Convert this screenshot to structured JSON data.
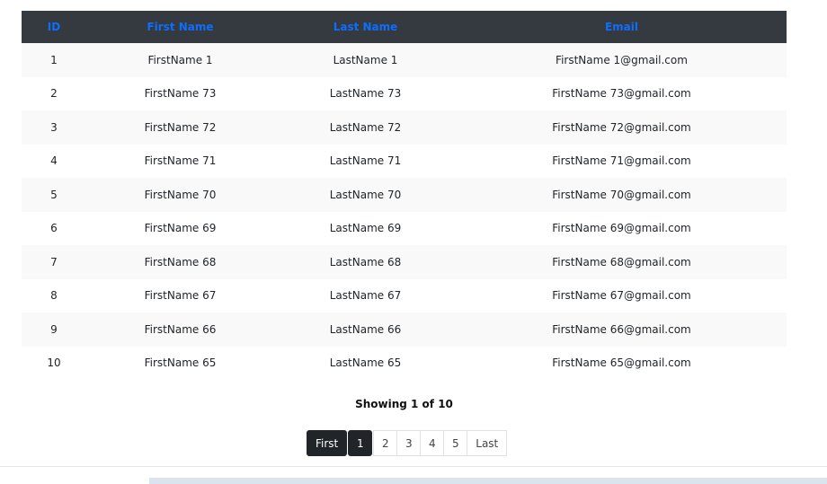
{
  "table": {
    "headers": [
      "ID",
      "First Name",
      "Last Name",
      "Email"
    ],
    "rows": [
      [
        "1",
        "FirstName 1",
        "LastName 1",
        "FirstName 1@gmail.com"
      ],
      [
        "2",
        "FirstName 73",
        "LastName 73",
        "FirstName 73@gmail.com"
      ],
      [
        "3",
        "FirstName 72",
        "LastName 72",
        "FirstName 72@gmail.com"
      ],
      [
        "4",
        "FirstName 71",
        "LastName 71",
        "FirstName 71@gmail.com"
      ],
      [
        "5",
        "FirstName 70",
        "LastName 70",
        "FirstName 70@gmail.com"
      ],
      [
        "6",
        "FirstName 69",
        "LastName 69",
        "FirstName 69@gmail.com"
      ],
      [
        "7",
        "FirstName 68",
        "LastName 68",
        "FirstName 68@gmail.com"
      ],
      [
        "8",
        "FirstName 67",
        "LastName 67",
        "FirstName 67@gmail.com"
      ],
      [
        "9",
        "FirstName 66",
        "LastName 66",
        "FirstName 66@gmail.com"
      ],
      [
        "10",
        "FirstName 65",
        "LastName 65",
        "FirstName 65@gmail.com"
      ]
    ]
  },
  "status": {
    "showing": "Showing 1 of 10"
  },
  "pagination": {
    "first": "First",
    "pages": [
      "1",
      "2",
      "3",
      "4",
      "5"
    ],
    "active_page": "1",
    "last": "Last"
  },
  "colors": {
    "header_bg": "#343a40",
    "header_text": "#0d6efd",
    "active_button": "#212529"
  }
}
